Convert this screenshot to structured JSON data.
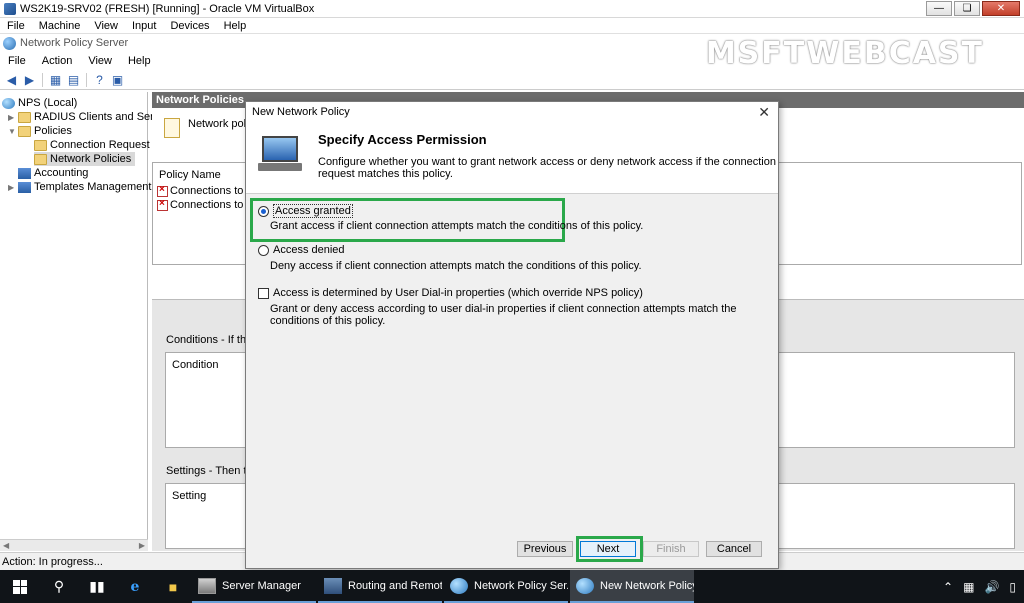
{
  "host": {
    "title": "WS2K19-SRV02 (FRESH) [Running] - Oracle VM VirtualBox",
    "menu": [
      "File",
      "Machine",
      "View",
      "Input",
      "Devices",
      "Help"
    ]
  },
  "app": {
    "title": "Network Policy Server",
    "watermark": "MSFTWEBCAST",
    "menu": [
      "File",
      "Action",
      "View",
      "Help"
    ]
  },
  "tree": {
    "items": [
      {
        "label": "NPS (Local)"
      },
      {
        "label": "RADIUS Clients and Servers"
      },
      {
        "label": "Policies"
      },
      {
        "label": "Connection Request Po"
      },
      {
        "label": "Network Policies"
      },
      {
        "label": "Accounting"
      },
      {
        "label": "Templates Management"
      }
    ]
  },
  "panel": {
    "header": "Network Policies",
    "description": "Network polici",
    "column_policy_name": "Policy Name",
    "rows": [
      "Connections to Micr",
      "Connections to othe"
    ],
    "conditions_label": "Conditions - If the folli",
    "condition_col": "Condition",
    "settings_label": "Settings - Then the fo",
    "setting_col": "Setting"
  },
  "status": "Action:  In progress...",
  "dialog": {
    "title": "New Network Policy",
    "heading": "Specify Access Permission",
    "heading_desc": "Configure whether you want to grant network access or deny network access if the connection request matches this policy.",
    "options": [
      {
        "label": "Access granted",
        "desc": "Grant access if client connection attempts match the conditions of this policy.",
        "selected": true
      },
      {
        "label": "Access denied",
        "desc": "Deny access if client connection attempts match the conditions of this policy.",
        "selected": false
      }
    ],
    "checkbox": {
      "label": "Access is determined by User Dial-in properties (which override NPS policy)",
      "desc": "Grant or deny access according to user dial-in properties if client connection attempts match the conditions of this policy.",
      "checked": false
    },
    "buttons": {
      "previous": "Previous",
      "next": "Next",
      "finish": "Finish",
      "cancel": "Cancel"
    }
  },
  "taskbar": {
    "apps": [
      {
        "label": "Server Manager"
      },
      {
        "label": "Routing and Remot..."
      },
      {
        "label": "Network Policy Ser..."
      },
      {
        "label": "New Network Policy"
      }
    ]
  },
  "colors": {
    "highlight": "#2aa84a",
    "header_bg": "#6c6c6c",
    "taskbar_bg": "#101418"
  }
}
